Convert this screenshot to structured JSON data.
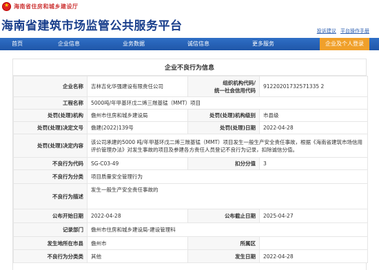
{
  "header": {
    "dept_name": "海南省住房和城乡建设厅",
    "site_title": "海南省建筑市场监管公共服务平台",
    "links": [
      "投诉建议",
      "平台操作手册"
    ]
  },
  "nav": {
    "items": [
      "首页",
      "企业信息",
      "业务数据",
      "诚信信息",
      "更多服务"
    ],
    "login_button": "企业及个人登录"
  },
  "main": {
    "section_title": "企业不良行为信息",
    "fields": {
      "company_name_label": "企业名称",
      "company_name": "吉林吉化华强建设有限责任公司",
      "credit_code_label_1": "组织机构代码/",
      "credit_code_label_2": "统一社会信用代码",
      "credit_code": "91220201732571335 2",
      "project_name_label": "工程名称",
      "project_name": "5000吨/年甲基环戊二烯三羰基锰（MMT）项目",
      "authority_label": "处罚(处理)机构",
      "authority": "儋州市住房和城乡建设局",
      "authority_level_label": "处罚(处理)机构级别",
      "authority_level": "市县级",
      "decision_no_label": "处罚(处理)决定文号",
      "decision_no": "儋建(2022)139号",
      "decision_date_label": "处罚(处理)日期",
      "decision_date": "2022-04-28",
      "decision_content_label": "处罚(处理)决定内容",
      "decision_content": "该公司承建的5000 吨/年甲基环戊二烯三羰基锰（MMT）项目发生一般生产安全责任事故，根据《海南省建筑市场信用评价管理办法》对发生事故的项目及参建各方责任人员登记不良行为记录，扣除诚信分值。",
      "behavior_code_label": "不良行为代码",
      "behavior_code": "SG-C03-49",
      "deduction_label": "扣分分值",
      "deduction": "3",
      "behavior_type_label": "不良行为分类",
      "behavior_type": "项目质量安全管理行为",
      "behavior_desc_label": "不良行为描述",
      "behavior_desc": "发生一般生产安全责任事故的",
      "publish_start_label": "公布开始日期",
      "publish_start": "2022-04-28",
      "publish_end_label": "公布截止日期",
      "publish_end": "2025-04-27",
      "record_dept_label": "记录部门",
      "record_dept": "儋州市住房和城乡建设局-建设管理科",
      "city_label": "发生地所在市县",
      "city": "儋州市",
      "district_label": "所属区",
      "district": "",
      "category_label": "不良行为分类类",
      "category": "其他",
      "occur_date_label": "发生日期",
      "occur_date": "2022-04-28"
    }
  },
  "colors": {
    "title_blue": "#1a3f8c",
    "nav_blue": "#2f6fc6",
    "login_orange": "#f0a02a",
    "dept_red": "#cc3333"
  }
}
